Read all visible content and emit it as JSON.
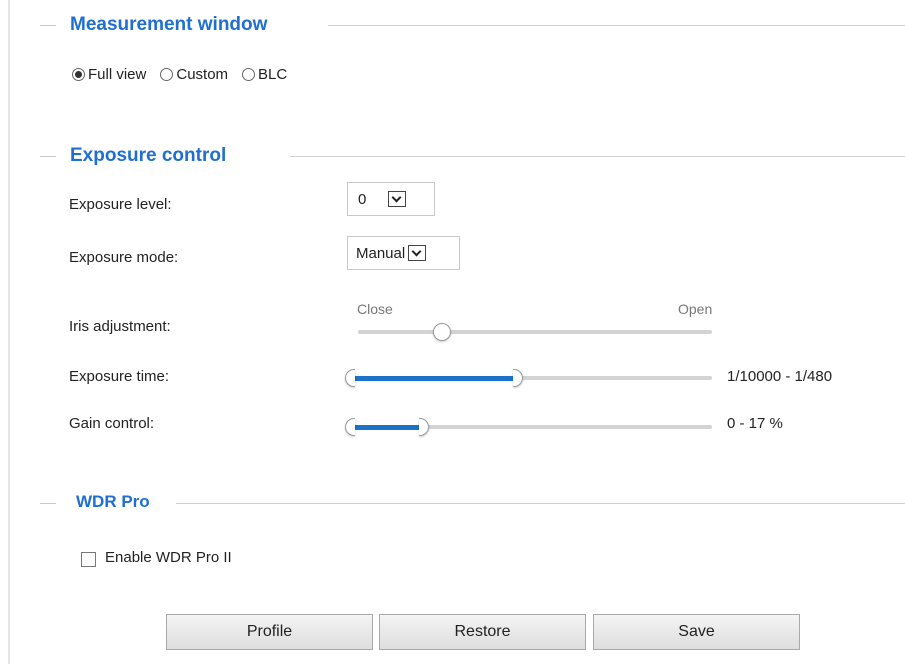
{
  "measurement_window": {
    "title": "Measurement window",
    "options": [
      {
        "label": "Full view",
        "checked": true
      },
      {
        "label": "Custom",
        "checked": false
      },
      {
        "label": "BLC",
        "checked": false
      }
    ]
  },
  "exposure_control": {
    "title": "Exposure control",
    "exposure_level": {
      "label": "Exposure level:",
      "value": "0"
    },
    "exposure_mode": {
      "label": "Exposure mode:",
      "value": "Manual"
    },
    "iris_adjustment": {
      "label": "Iris adjustment:",
      "min_label": "Close",
      "max_label": "Open"
    },
    "exposure_time": {
      "label": "Exposure time:",
      "value": "1/10000 - 1/480"
    },
    "gain_control": {
      "label": "Gain control:",
      "value": "0 - 17 %"
    }
  },
  "wdr_pro": {
    "title": "WDR Pro",
    "enable_label": "Enable WDR Pro II",
    "enabled": false
  },
  "buttons": {
    "profile": "Profile",
    "restore": "Restore",
    "save": "Save"
  },
  "colors": {
    "accent": "#1f6fd1",
    "slider_fill": "#1a73c9"
  }
}
